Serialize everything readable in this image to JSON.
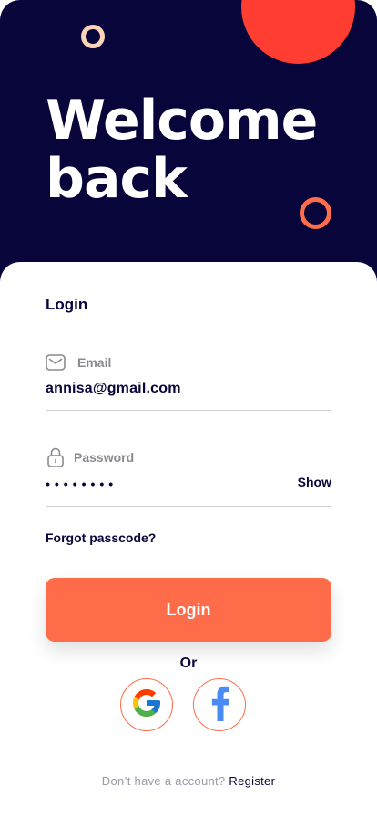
{
  "hero": {
    "title_line1": "Welcome",
    "title_line2": "back"
  },
  "login_form": {
    "section_title": "Login",
    "email": {
      "icon": "mail-icon",
      "label": "Email",
      "value": "annisa@gmail.com"
    },
    "password": {
      "icon": "lock-icon",
      "label": "Password",
      "masked_value": "••••••••",
      "toggle_label": "Show"
    },
    "forgot_label": "Forgot passcode?",
    "submit_label": "Login"
  },
  "social": {
    "divider_label": "Or",
    "providers": [
      {
        "name": "Google",
        "icon": "google-icon"
      },
      {
        "name": "Facebook",
        "icon": "facebook-icon"
      }
    ]
  },
  "footer": {
    "question": "Don’t have a account?",
    "register_label": "Register"
  },
  "colors": {
    "navy": "#07053a",
    "accent": "#ff6c4a",
    "deco_red": "#ff3d30",
    "deco_peach": "#fbd3b8"
  }
}
